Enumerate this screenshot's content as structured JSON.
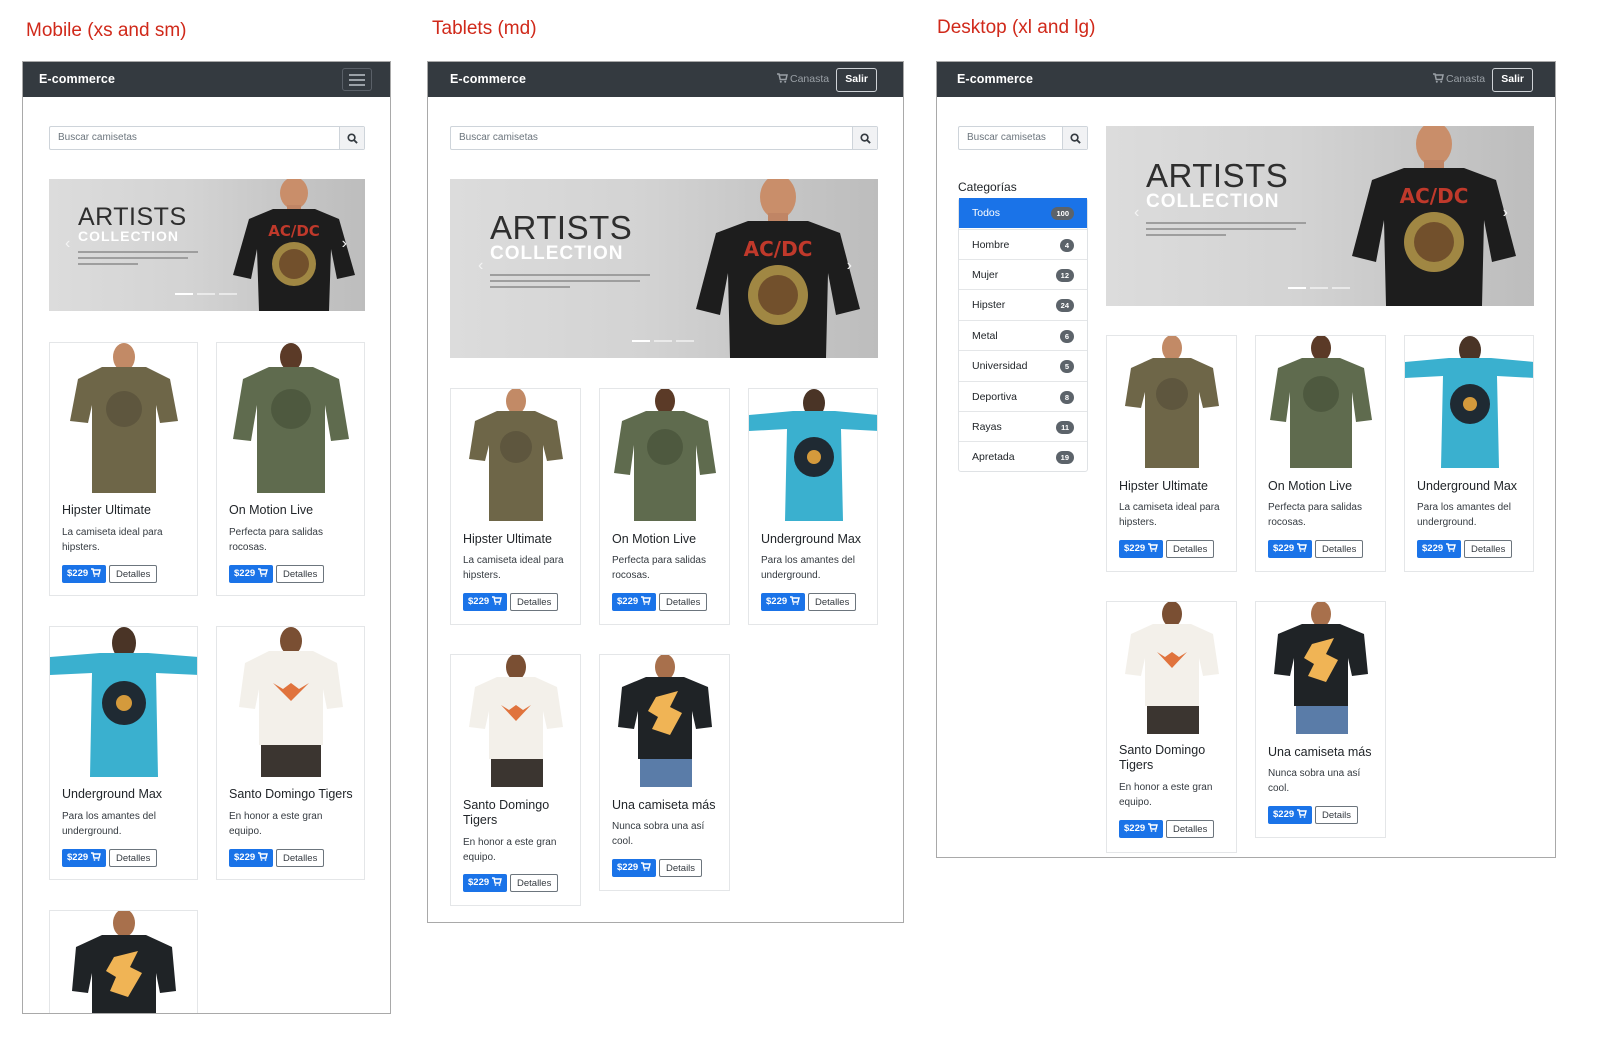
{
  "viewports": {
    "mobile_label": "Mobile (xs and sm)",
    "tablet_label": "Tablets (md)",
    "desktop_label": "Desktop (xl and lg)"
  },
  "navbar": {
    "brand": "E-commerce",
    "cart_label": "Canasta",
    "logout_label": "Salir"
  },
  "search": {
    "placeholder": "Buscar camisetas"
  },
  "carousel": {
    "line1": "ARTISTS",
    "line2": "COLLECTION",
    "slides": 3,
    "active_slide": 1
  },
  "categories": {
    "heading": "Categorías",
    "items": [
      {
        "label": "Todos",
        "count": "100",
        "active": true
      },
      {
        "label": "Hombre",
        "count": "4"
      },
      {
        "label": "Mujer",
        "count": "12"
      },
      {
        "label": "Hipster",
        "count": "24"
      },
      {
        "label": "Metal",
        "count": "6"
      },
      {
        "label": "Universidad",
        "count": "5"
      },
      {
        "label": "Deportiva",
        "count": "8"
      },
      {
        "label": "Rayas",
        "count": "11"
      },
      {
        "label": "Apretada",
        "count": "19"
      }
    ]
  },
  "products": [
    {
      "title": "Hipster Ultimate",
      "desc": "La camiseta ideal para hipsters.",
      "price": "$229",
      "details": "Detalles"
    },
    {
      "title": "On Motion Live",
      "desc": "Perfecta para salidas rocosas.",
      "price": "$229",
      "details": "Detalles"
    },
    {
      "title": "Underground Max",
      "desc": "Para los amantes del underground.",
      "price": "$229",
      "details": "Detalles"
    },
    {
      "title": "Santo Domingo Tigers",
      "desc": "En honor a este gran equipo.",
      "price": "$229",
      "details": "Detalles"
    },
    {
      "title": "Una camiseta más",
      "desc": "Nunca sobra una así cool.",
      "price": "$229",
      "details": "Details"
    }
  ],
  "colors": {
    "navbar": "#343a40",
    "primary": "#1a73e8",
    "label_red": "#d0291a",
    "shirt_olive": "#6e6648",
    "shirt_green": "#5f6b4e",
    "shirt_blue": "#3ab0cf",
    "shirt_white": "#f3f0ea",
    "shirt_black": "#1f2326",
    "carousel_shirt": "#1d1d1d"
  }
}
